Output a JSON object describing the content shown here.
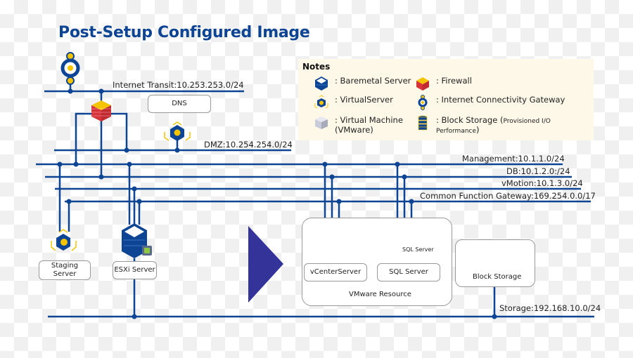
{
  "title": "Post-Setup Configured Image",
  "colors": {
    "line": "#0d4594",
    "title": "#0d4594",
    "arrow": "#333399",
    "notes_bg": "#fdf8e8",
    "gold": "#f5c400",
    "firewall_red": "#d6333a"
  },
  "networks": {
    "internet_transit": "Internet Transit:10.253.253.0/24",
    "dmz": "DMZ:10.254.254.0/24",
    "management": "Management:10.1.1.0/24",
    "db": "DB:10.1.2.0:/24",
    "vmotion": "vMotion:10.1.3.0/24",
    "common_function": "Common Function Gateway:169.254.0.0/17",
    "storage": "Storage:192.168.10.0/24"
  },
  "nodes": {
    "dns": "DNS",
    "staging": "Staging\nServer",
    "esxi": "ESXi Server",
    "vcenter": "vCenterServer",
    "sql": "SQL Server",
    "sql_logo_text": "SQL Server",
    "vmware_resource": "VMware Resource",
    "block_storage": "Block Storage"
  },
  "notes": {
    "title": "Notes",
    "items": [
      {
        "icon": "baremetal-server-icon",
        "label": ": Baremetal Server"
      },
      {
        "icon": "firewall-icon",
        "label": ": Firewall"
      },
      {
        "icon": "virtual-server-icon",
        "label": ": VirtualServer"
      },
      {
        "icon": "internet-gateway-icon",
        "label": ": Internet Connectivity Gateway"
      },
      {
        "icon": "virtual-machine-icon",
        "label": ": Virtual Machine\n(VMware)"
      },
      {
        "icon": "block-storage-icon",
        "label": ": Block Storage (",
        "suffix": "Provisioned I/O Performance",
        "suffix_end": ")"
      }
    ]
  }
}
